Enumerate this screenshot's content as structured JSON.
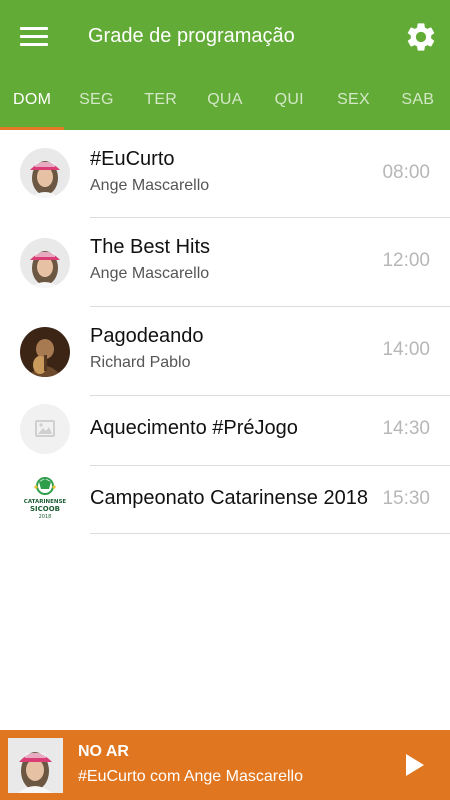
{
  "header": {
    "title": "Grade de programação",
    "menu_icon": "menu-icon",
    "settings_icon": "gear-icon",
    "bg_color": "#63ab37"
  },
  "tabs": [
    {
      "label": "DOM",
      "active": true
    },
    {
      "label": "SEG",
      "active": false
    },
    {
      "label": "TER",
      "active": false
    },
    {
      "label": "QUA",
      "active": false
    },
    {
      "label": "QUI",
      "active": false
    },
    {
      "label": "SEX",
      "active": false
    },
    {
      "label": "SAB",
      "active": false
    }
  ],
  "accent_color": "#e07a24",
  "schedule": [
    {
      "title": "#EuCurto",
      "host": "Ange Mascarello",
      "time": "08:00",
      "avatar": "host-photo"
    },
    {
      "title": "The Best Hits",
      "host": "Ange Mascarello",
      "time": "12:00",
      "avatar": "host-photo"
    },
    {
      "title": "Pagodeando",
      "host": "Richard Pablo",
      "time": "14:00",
      "avatar": "musician-photo"
    },
    {
      "title": "Aquecimento #PréJogo",
      "host": "",
      "time": "14:30",
      "avatar": "image-placeholder-icon"
    },
    {
      "title": "Campeonato Catarinense 2018",
      "host": "",
      "time": "15:30",
      "avatar": "championship-logo",
      "logo_text": [
        "CATARINENSE",
        "SICOOB",
        "2018"
      ]
    }
  ],
  "player": {
    "label": "NO AR",
    "now_playing": "#EuCurto com Ange Mascarello",
    "play_icon": "play-icon",
    "bg_color": "#e0761f"
  }
}
